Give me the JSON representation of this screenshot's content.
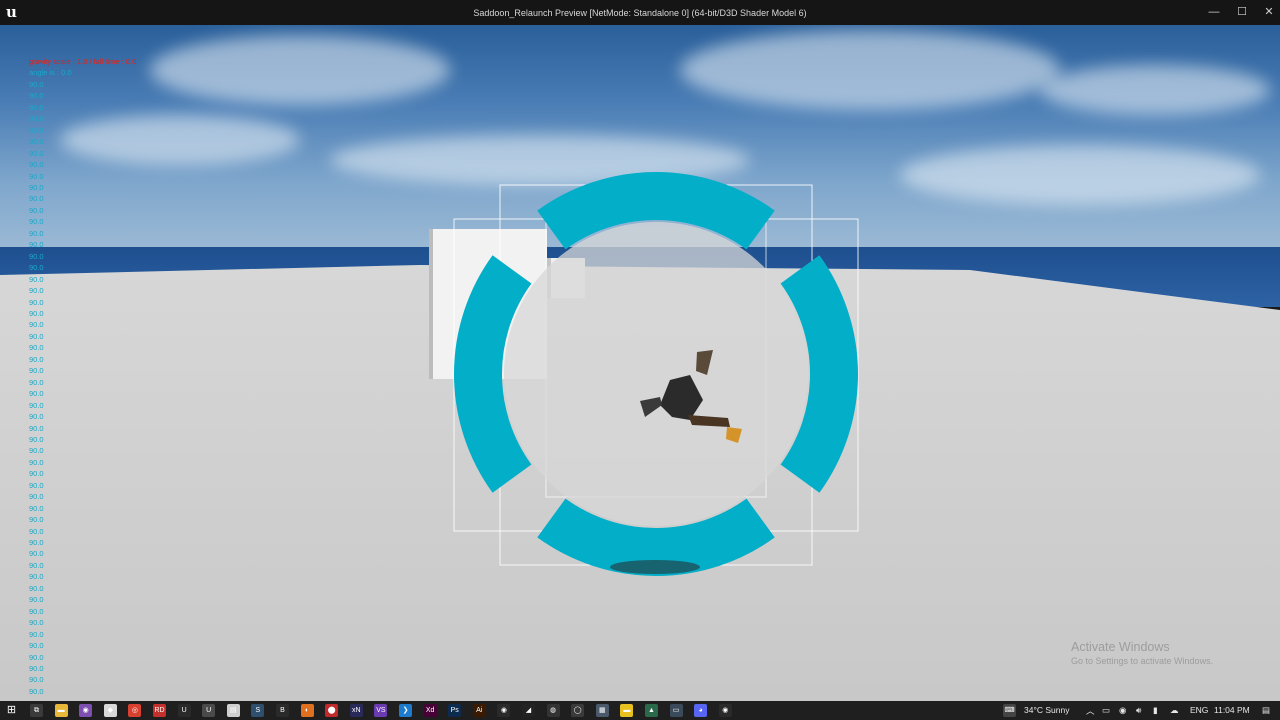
{
  "window": {
    "title": "Saddoon_Relaunch Preview [NetMode: Standalone 0]  (64-bit/D3D Shader Model 6)",
    "logo_glyph": "u",
    "minimize_glyph": "—",
    "maximize_glyph": "☐",
    "close_glyph": "✕"
  },
  "debug": {
    "header_line": "gravity scale : 1.0 / fall time : 0.0",
    "angle_line": "angle is : 0.0",
    "repeat_value": "90.0",
    "repeat_count": 54,
    "colors": {
      "header": "#e0211a",
      "values": "#18a9c9"
    }
  },
  "reticle": {
    "color": "#03aec8"
  },
  "watermark": {
    "line1": "Activate Windows",
    "line2": "Go to Settings to activate Windows."
  },
  "taskbar": {
    "start_icon": "windows-start-icon",
    "apps": [
      {
        "name": "task-view-icon",
        "color": "#3a3a3a",
        "glyph": "⧉"
      },
      {
        "name": "file-explorer-icon",
        "color": "#e8b73a",
        "glyph": "▬"
      },
      {
        "name": "tor-browser-icon",
        "color": "#7d4fb0",
        "glyph": "◉"
      },
      {
        "name": "app-icon",
        "color": "#d9d9d9",
        "glyph": "◆"
      },
      {
        "name": "chrome-icon",
        "color": "#d8402f",
        "glyph": "◎"
      },
      {
        "name": "davinci-icon",
        "color": "#c4302b",
        "glyph": "RD"
      },
      {
        "name": "unreal-editor-icon",
        "color": "#2a2a2a",
        "glyph": "U"
      },
      {
        "name": "unreal-editor-active-icon",
        "color": "#4a4a4a",
        "glyph": "U"
      },
      {
        "name": "notepad-icon",
        "color": "#cfcfcf",
        "glyph": "▤"
      },
      {
        "name": "steam-icon",
        "color": "#2f4f6f",
        "glyph": "S"
      },
      {
        "name": "blender-icon",
        "color": "#2a2a2a",
        "glyph": "B"
      },
      {
        "name": "app-orange-icon",
        "color": "#e07020",
        "glyph": "◐"
      },
      {
        "name": "app-red-icon",
        "color": "#c02a2a",
        "glyph": "⬤"
      },
      {
        "name": "app-xn-icon",
        "color": "#2a2a5a",
        "glyph": "xN"
      },
      {
        "name": "visual-studio-icon",
        "color": "#6a3ab0",
        "glyph": "VS"
      },
      {
        "name": "vscode-icon",
        "color": "#1e7acc",
        "glyph": "❯"
      },
      {
        "name": "adobe-xd-icon",
        "color": "#470137",
        "glyph": "Xd"
      },
      {
        "name": "photoshop-icon",
        "color": "#0c2b4f",
        "glyph": "Ps"
      },
      {
        "name": "illustrator-icon",
        "color": "#3a1a00",
        "glyph": "Ai"
      },
      {
        "name": "blender-orange-icon",
        "color": "#2a2a2a",
        "glyph": "◉"
      },
      {
        "name": "unity-icon",
        "color": "#222",
        "glyph": "◢"
      },
      {
        "name": "obs-icon",
        "color": "#333",
        "glyph": "◍"
      },
      {
        "name": "app-circle-icon",
        "color": "#3a3a3a",
        "glyph": "◯"
      },
      {
        "name": "calculator-icon",
        "color": "#4a5a6a",
        "glyph": "▦"
      },
      {
        "name": "sticky-notes-icon",
        "color": "#e8c020",
        "glyph": "▬"
      },
      {
        "name": "app-green-icon",
        "color": "#2a6a4a",
        "glyph": "▲"
      },
      {
        "name": "app-monitor-icon",
        "color": "#3a4a5a",
        "glyph": "▭"
      },
      {
        "name": "discord-icon",
        "color": "#5865f2",
        "glyph": "◕"
      },
      {
        "name": "blender-app-icon",
        "color": "#2a2a2a",
        "glyph": "◉"
      }
    ],
    "weather": "34°C  Sunny",
    "language": "ENG",
    "time": "11:04 PM"
  }
}
